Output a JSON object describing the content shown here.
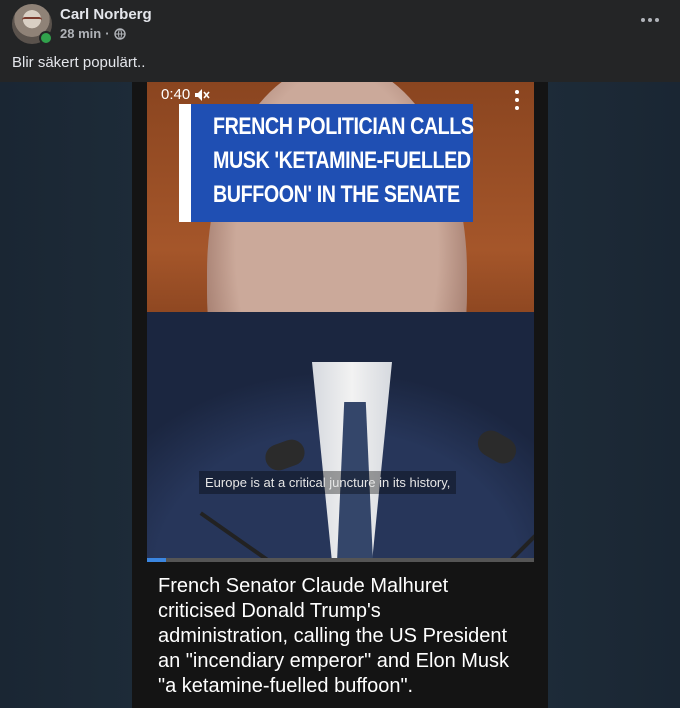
{
  "post": {
    "author": "Carl Norberg",
    "time": "28 min",
    "separator": "·",
    "text": "Blir säkert populärt.."
  },
  "icons": {
    "privacy": "globe-icon",
    "menu": "more-horizontal-icon",
    "video_menu": "more-vertical-icon",
    "volume": "mute-icon"
  },
  "video": {
    "time": "0:40",
    "headline_lines": [
      "FRENCH POLITICIAN CALLS",
      "MUSK 'KETAMINE-FUELLED",
      "BUFFOON' IN THE SENATE"
    ],
    "subtitle": "Europe is at a critical juncture in its history,",
    "progress": 0.05,
    "caption_lines": [
      "French Senator Claude Malhuret",
      "criticised Donald Trump's",
      "administration, calling the US President",
      "an \"incendiary emperor\" and Elon Musk",
      "\"a ketamine-fuelled buffoon\"."
    ]
  },
  "colors": {
    "background": "#242526",
    "headline_bg": "#1f4fb3",
    "online": "#31a24c",
    "progress": "#3b86e0"
  }
}
